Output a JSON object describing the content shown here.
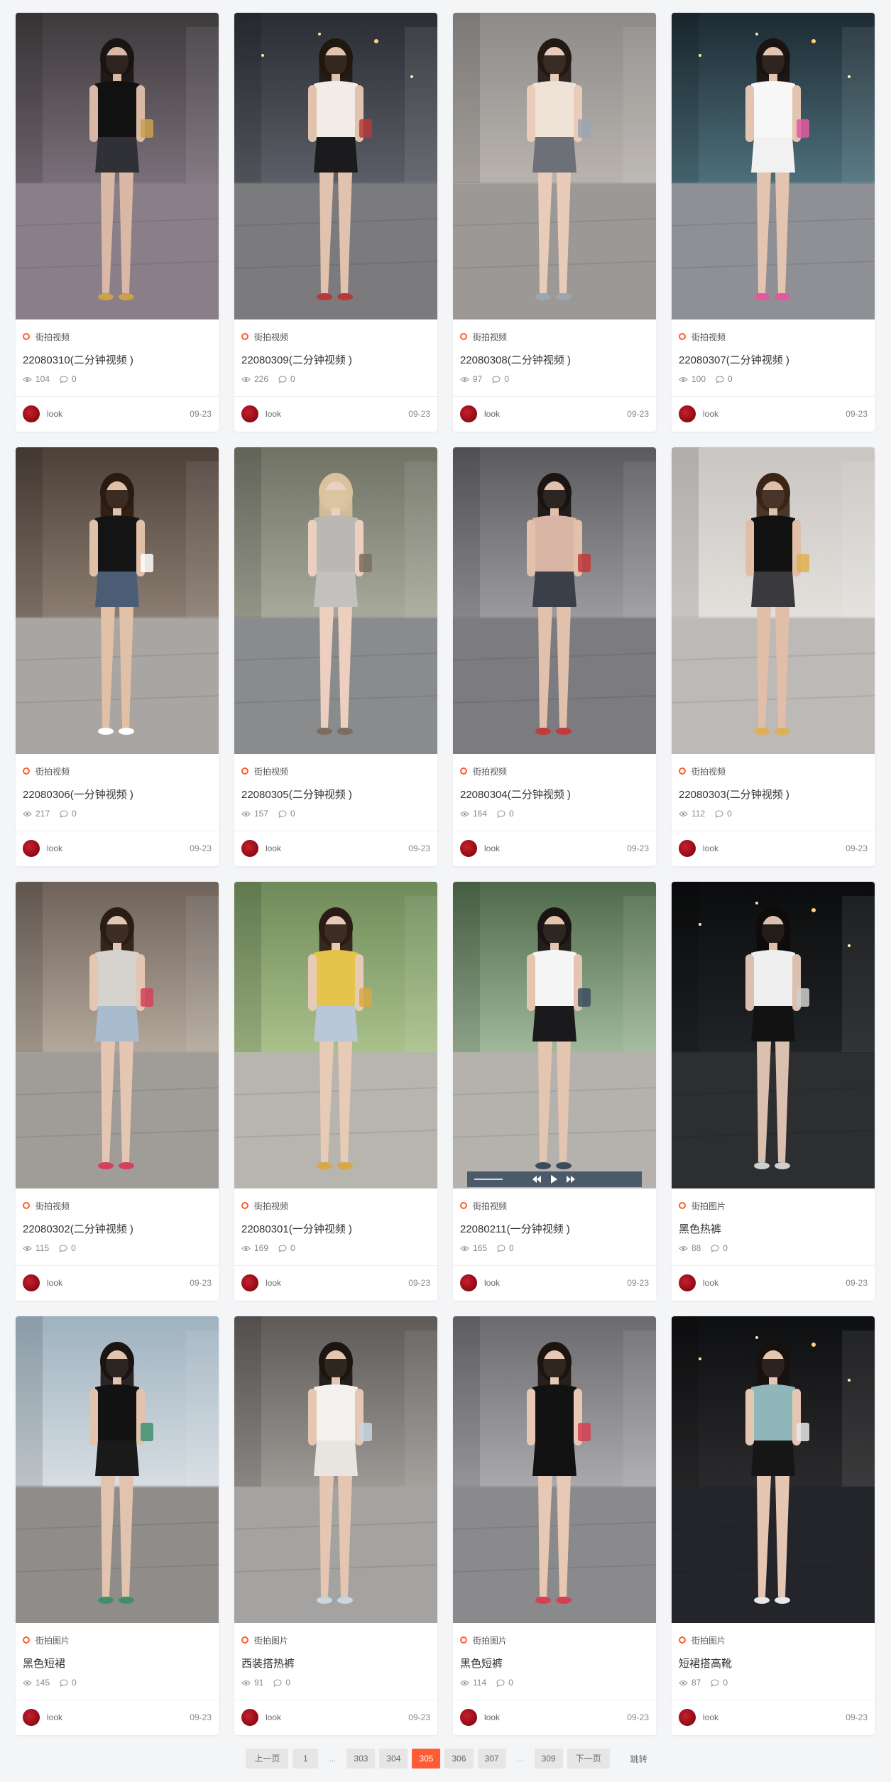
{
  "cards": [
    {
      "category": "街拍视频",
      "title": "22080310(二分钟视频 )",
      "views": "104",
      "comments": "0",
      "author": "look",
      "date": "09-23",
      "palette": {
        "bg1": "#3d3a3c",
        "bg2": "#7a6f79",
        "ground": "#8a7f88",
        "top": "#111111",
        "bottom": "#2f3136",
        "skin": "#d9b9a5",
        "hair": "#1a1412",
        "accent": "#c9a24b"
      }
    },
    {
      "category": "街拍视频",
      "title": "22080309(二分钟视频 )",
      "views": "226",
      "comments": "0",
      "author": "look",
      "date": "09-23",
      "palette": {
        "bg1": "#2a2d33",
        "bg2": "#5b5e66",
        "ground": "#7b7a7c",
        "top": "#f1ece6",
        "bottom": "#1b1b1d",
        "skin": "#e1c2ae",
        "hair": "#20170f",
        "accent": "#b73a3a"
      }
    },
    {
      "category": "街拍视频",
      "title": "22080308(二分钟视频 )",
      "views": "97",
      "comments": "0",
      "author": "look",
      "date": "09-23",
      "palette": {
        "bg1": "#8d8a88",
        "bg2": "#b8b3ae",
        "ground": "#9c9895",
        "top": "#eee3d6",
        "bottom": "#6e7077",
        "skin": "#e8cbb8",
        "hair": "#241a14",
        "accent": "#9aa6b2"
      }
    },
    {
      "category": "街拍视频",
      "title": "22080307(二分钟视频 )",
      "views": "100",
      "comments": "0",
      "author": "look",
      "date": "09-23",
      "palette": {
        "bg1": "#1d2a33",
        "bg2": "#4d6f7a",
        "ground": "#8f9095",
        "top": "#f7f7f7",
        "bottom": "#f1f1f1",
        "skin": "#e3c4b0",
        "hair": "#1b1310",
        "accent": "#e05a9d"
      }
    },
    {
      "category": "街拍视频",
      "title": "22080306(一分钟视频 )",
      "views": "217",
      "comments": "0",
      "author": "look",
      "date": "09-23",
      "palette": {
        "bg1": "#4c4038",
        "bg2": "#8a7c70",
        "ground": "#a8a5a2",
        "top": "#141414",
        "bottom": "#4a5d75",
        "skin": "#e1c0a8",
        "hair": "#2a1b12",
        "accent": "#ffffff"
      }
    },
    {
      "category": "街拍视频",
      "title": "22080305(二分钟视频 )",
      "views": "157",
      "comments": "0",
      "author": "look",
      "date": "09-23",
      "palette": {
        "bg1": "#6f7264",
        "bg2": "#a7a99a",
        "ground": "#8a8b8c",
        "top": "#b9b8b5",
        "bottom": "#c2c1bd",
        "skin": "#eccfbf",
        "hair": "#d9c29c",
        "accent": "#7b6d62"
      }
    },
    {
      "category": "街拍视频",
      "title": "22080304(二分钟视频 )",
      "views": "164",
      "comments": "0",
      "author": "look",
      "date": "09-23",
      "palette": {
        "bg1": "#5b5b5e",
        "bg2": "#9a9a9e",
        "ground": "#7c7c80",
        "top": "#d8b5a5",
        "bottom": "#3b3f4a",
        "skin": "#e2c1ac",
        "hair": "#1a1412",
        "accent": "#c23a3a"
      }
    },
    {
      "category": "街拍视频",
      "title": "22080303(二分钟视频 )",
      "views": "112",
      "comments": "0",
      "author": "look",
      "date": "09-23",
      "palette": {
        "bg1": "#c9c5c2",
        "bg2": "#e3e0dc",
        "ground": "#bdb9b6",
        "top": "#111111",
        "bottom": "#3a3a3e",
        "skin": "#e0bea8",
        "hair": "#3a2518",
        "accent": "#e0b050"
      }
    },
    {
      "category": "街拍视频",
      "title": "22080302(二分钟视频 )",
      "views": "115",
      "comments": "0",
      "author": "look",
      "date": "09-23",
      "palette": {
        "bg1": "#6e625a",
        "bg2": "#b3a79b",
        "ground": "#a09c98",
        "top": "#d6d3cf",
        "bottom": "#a9bccd",
        "skin": "#e5c6b2",
        "hair": "#2a1d15",
        "accent": "#d6405a"
      }
    },
    {
      "category": "街拍视频",
      "title": "22080301(一分钟视频 )",
      "views": "169",
      "comments": "0",
      "author": "look",
      "date": "09-23",
      "palette": {
        "bg1": "#6f8a5a",
        "bg2": "#a9c08a",
        "ground": "#b8b4ae",
        "top": "#e6c34a",
        "bottom": "#b9c8d6",
        "skin": "#e8cbb6",
        "hair": "#2a1c14",
        "accent": "#d8a843"
      }
    },
    {
      "category": "街拍视频",
      "title": "22080211(一分钟视频 )",
      "views": "165",
      "comments": "0",
      "author": "look",
      "date": "09-23",
      "palette": {
        "bg1": "#4f6a4a",
        "bg2": "#9fb79a",
        "ground": "#b5b2ae",
        "top": "#f5f5f5",
        "bottom": "#1a1a1c",
        "skin": "#e4c5b0",
        "hair": "#1a1412",
        "accent": "#3b4c5e",
        "controls": true
      }
    },
    {
      "category": "街拍图片",
      "title": "黑色热裤",
      "views": "88",
      "comments": "0",
      "author": "look",
      "date": "09-23",
      "palette": {
        "bg1": "#0b0c0d",
        "bg2": "#202326",
        "ground": "#2c2e30",
        "top": "#efefef",
        "bottom": "#121212",
        "skin": "#dbc0b0",
        "hair": "#0e0b0a",
        "accent": "#cfcfcf"
      }
    },
    {
      "category": "街拍图片",
      "title": "黑色短裙",
      "views": "145",
      "comments": "0",
      "author": "look",
      "date": "09-23",
      "palette": {
        "bg1": "#9fb2c0",
        "bg2": "#d6dde2",
        "ground": "#8f8c89",
        "top": "#121212",
        "bottom": "#1a1a1a",
        "skin": "#e2c3ae",
        "hair": "#1a1412",
        "accent": "#3f8f6d"
      }
    },
    {
      "category": "街拍图片",
      "title": "西装搭热裤",
      "views": "91",
      "comments": "0",
      "author": "look",
      "date": "09-23",
      "palette": {
        "bg1": "#5d5a58",
        "bg2": "#9c9894",
        "ground": "#a4a3a1",
        "top": "#f3f1ed",
        "bottom": "#e8e4de",
        "skin": "#e4c6b2",
        "hair": "#1c1511",
        "accent": "#c9d6e0"
      }
    },
    {
      "category": "街拍图片",
      "title": "黑色短裤",
      "views": "114",
      "comments": "0",
      "author": "look",
      "date": "09-23",
      "palette": {
        "bg1": "#6b6a6e",
        "bg2": "#a9a8ab",
        "ground": "#8a898c",
        "top": "#121212",
        "bottom": "#111111",
        "skin": "#e6c8b5",
        "hair": "#1d1410",
        "accent": "#d64050"
      }
    },
    {
      "category": "街拍图片",
      "title": "短裙搭高靴",
      "views": "87",
      "comments": "0",
      "author": "look",
      "date": "09-23",
      "palette": {
        "bg1": "#0e0f11",
        "bg2": "#2a2a2c",
        "ground": "#24252a",
        "top": "#8fb6b8",
        "bottom": "#161616",
        "skin": "#e5c6b3",
        "hair": "#17110e",
        "accent": "#e8e8e8"
      }
    }
  ],
  "pager": {
    "prev": "上一页",
    "pages_left": [
      "1"
    ],
    "ellipsis": "...",
    "pages_mid": [
      "303",
      "304",
      "305",
      "306",
      "307"
    ],
    "active": "305",
    "pages_right": [
      "309"
    ],
    "next": "下一页",
    "jump": "跳转"
  },
  "colors": {
    "accent": "#ff5c33",
    "avatar": "#b3141f",
    "page_bg": "#f4f5f7"
  }
}
